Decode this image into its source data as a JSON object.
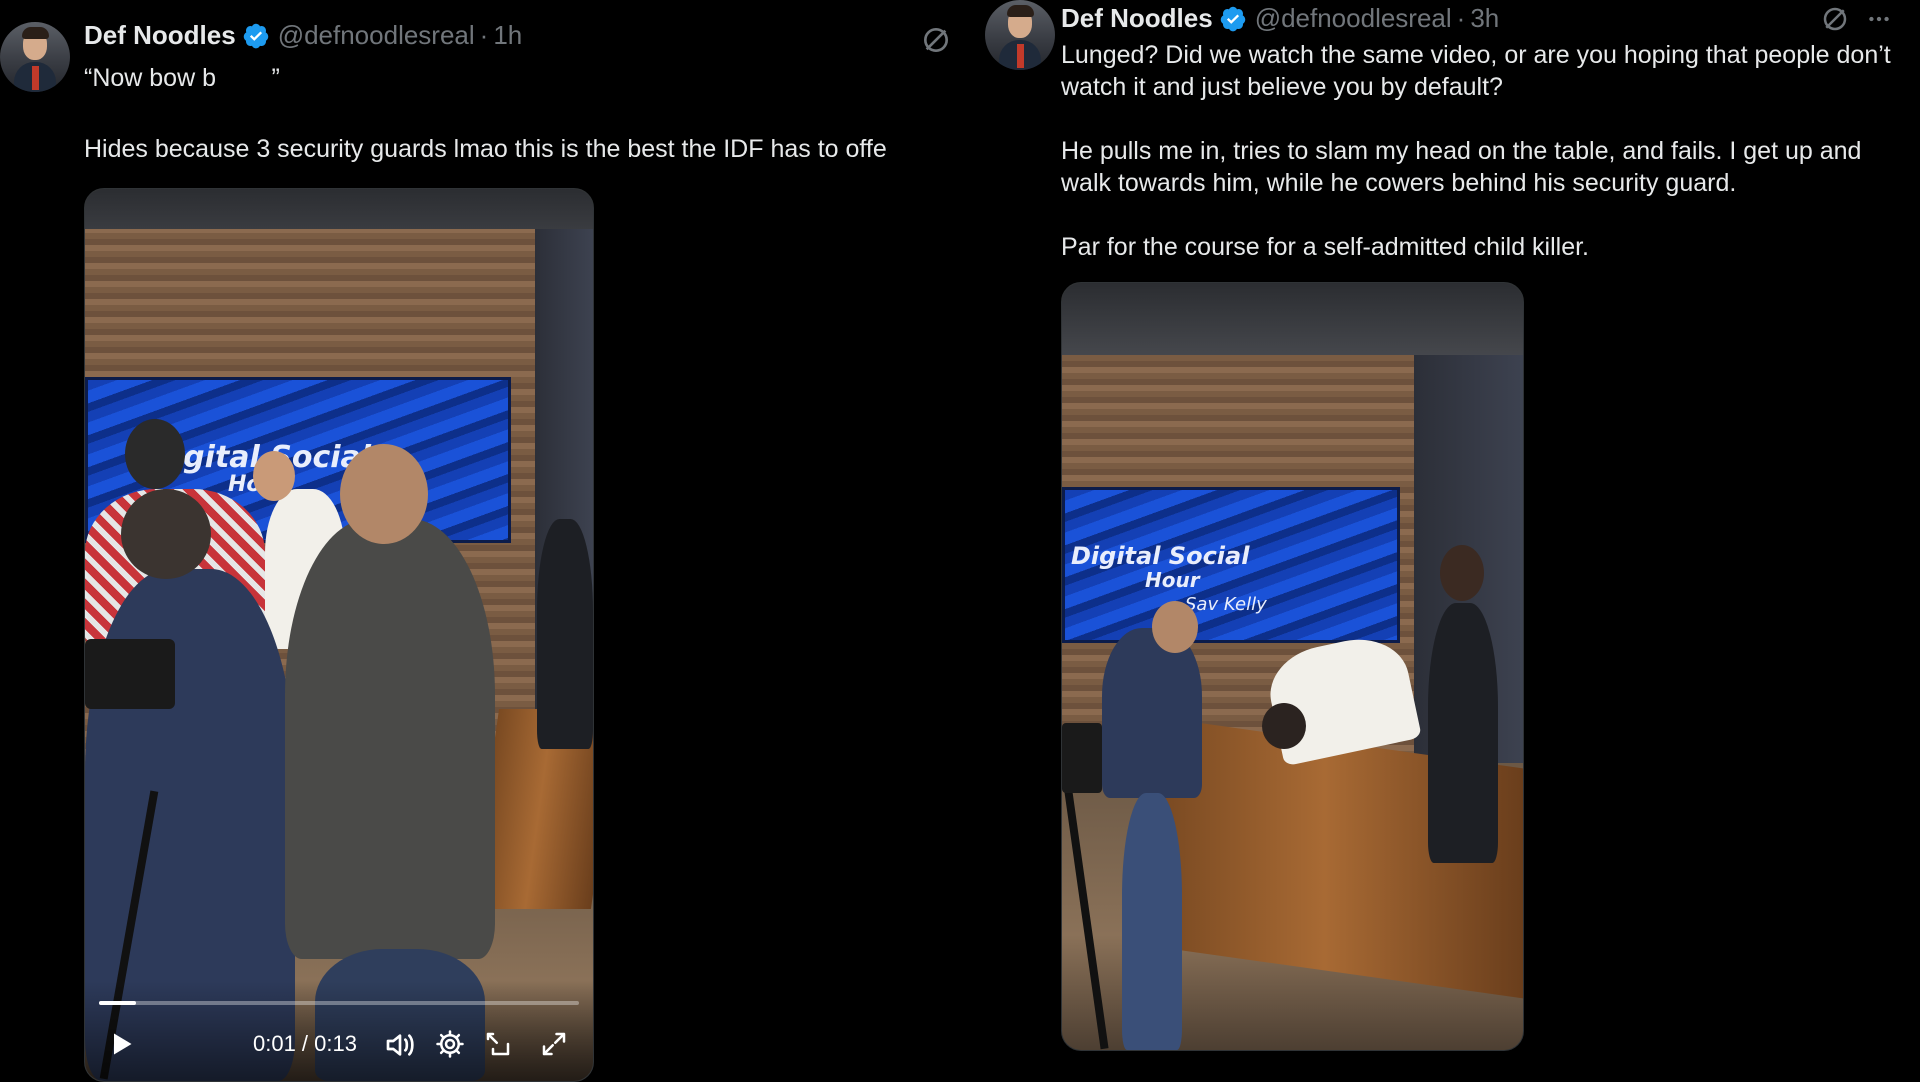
{
  "left_tweet": {
    "display_name": "Def Noodles",
    "handle": "@defnoodlesreal",
    "separator": "·",
    "time": "1h",
    "text_line1": "“Now bow b        ”",
    "text_line2": "Hides because 3 security guards lmao this is the best the IDF has to offe",
    "video": {
      "screen_text": "Digital Social",
      "screen_text2": "Ho",
      "current_time": "0:01 / 0:13",
      "progress": 0.077,
      "icons": [
        "play-icon",
        "volume-icon",
        "settings-gear-icon",
        "pip-icon",
        "fullscreen-icon"
      ]
    }
  },
  "right_tweet": {
    "display_name": "Def Noodles",
    "handle": "@defnoodlesreal",
    "separator": "·",
    "time": "3h",
    "paragraph1": "Lunged? Did we watch the same video, or are you hoping that people don’t\nwatch it and just believe you by default?",
    "paragraph2": "He pulls me in, tries to slam my head on the table, and fails. I get up and\nwalk towards him, while he cowers behind his security guard.",
    "paragraph3": "Par for the course for a self-admitted child killer.",
    "video": {
      "screen_text": "Digital Social",
      "screen_text2": "Hour",
      "screen_sub": "Sav Kelly"
    }
  },
  "colors": {
    "background": "#000000",
    "text_primary": "#e7e9ea",
    "text_secondary": "#71767b",
    "verified_blue": "#1d9bf0"
  }
}
